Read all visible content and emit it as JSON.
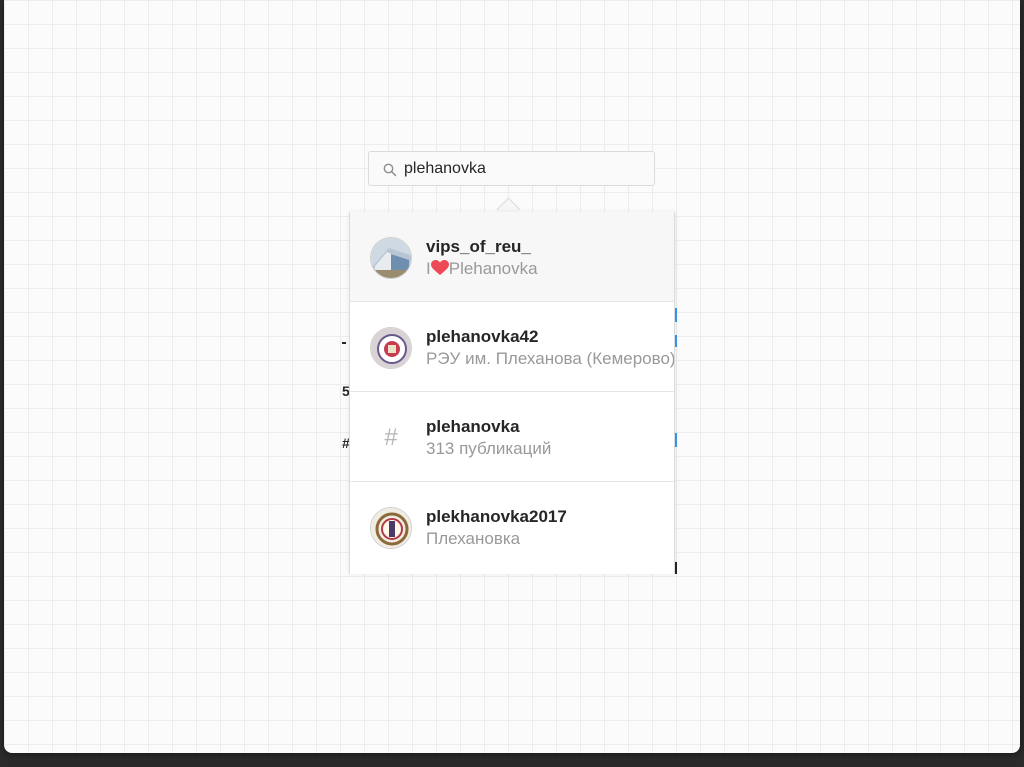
{
  "search": {
    "icon": "search-icon",
    "query": "plehanovka"
  },
  "results": [
    {
      "title": "vips_of_reu_",
      "subtitle_prefix": "I",
      "subtitle_emoji": "heart-icon",
      "subtitle_rest": "Plehanovka",
      "icon": "profile-avatar"
    },
    {
      "title": "plehanovka42",
      "subtitle": "РЭУ им. Плеханова (Кемерово)",
      "icon": "profile-avatar"
    },
    {
      "title": "plehanovka",
      "subtitle": "313 публикаций",
      "icon": "hashtag-icon",
      "hash_symbol": "#"
    },
    {
      "title": "plekhanovka2017",
      "subtitle": "Плехановка",
      "icon": "profile-avatar"
    }
  ],
  "colors": {
    "accent": "#3897f0",
    "text_primary": "#262626",
    "text_secondary": "#999999",
    "heart": "#ed4956"
  }
}
